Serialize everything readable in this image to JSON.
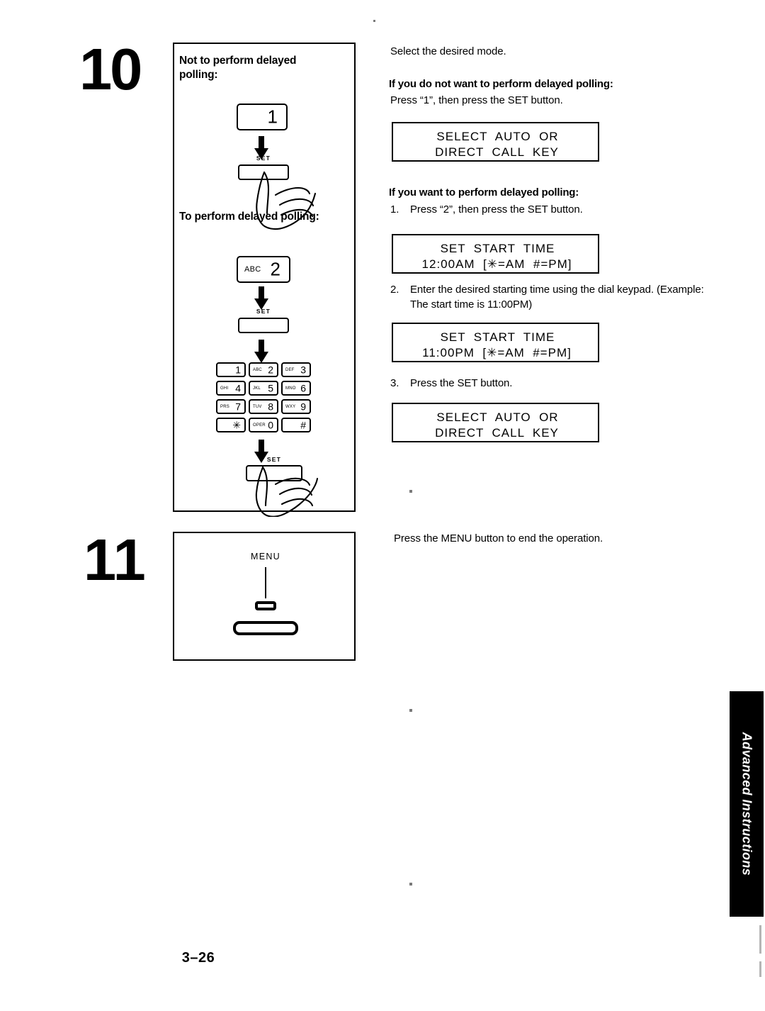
{
  "page": {
    "number": "3–26",
    "side_tab": "Advanced Instructions"
  },
  "steps": [
    {
      "number": "10",
      "panel": {
        "heading_not": "Not to perform delayed polling:",
        "heading_to": "To perform delayed polling:",
        "key_1": {
          "letters": "",
          "digit": "1"
        },
        "key_2": {
          "letters": "ABC",
          "digit": "2"
        },
        "set_label_1": "SET",
        "set_label_2": "SET",
        "set_label_3": "SET",
        "keypad": [
          {
            "letters": "",
            "digit": "1"
          },
          {
            "letters": "ABC",
            "digit": "2"
          },
          {
            "letters": "DEF",
            "digit": "3"
          },
          {
            "letters": "GHI",
            "digit": "4"
          },
          {
            "letters": "JKL",
            "digit": "5"
          },
          {
            "letters": "MNO",
            "digit": "6"
          },
          {
            "letters": "PRS",
            "digit": "7"
          },
          {
            "letters": "TUV",
            "digit": "8"
          },
          {
            "letters": "WXY",
            "digit": "9"
          },
          {
            "letters": "",
            "digit": "✳"
          },
          {
            "letters": "OPER",
            "digit": "0"
          },
          {
            "letters": "",
            "digit": "#"
          }
        ]
      }
    },
    {
      "number": "11",
      "panel": {
        "menu_label": "MENU"
      }
    }
  ],
  "instructions": {
    "select_mode": "Select the desired mode.",
    "heading_do_not": "If you do not want to perform delayed polling:",
    "press_1": "Press “1”, then press the SET button.",
    "heading_want": "If you want to perform delayed polling:",
    "item_1_marker": "1.",
    "item_1_text": "Press “2”, then press the SET button.",
    "item_2_marker": "2.",
    "item_2_text": "Enter the desired starting time using the dial keypad. (Example:  The start time is 11:00PM)",
    "item_3_marker": "3.",
    "item_3_text": "Press the SET button.",
    "menu_end": "Press the MENU button to end the operation."
  },
  "displays": [
    {
      "line1": "SELECT  AUTO  OR",
      "line2": "DIRECT  CALL  KEY"
    },
    {
      "line1": "SET  START  TIME",
      "line2": "12:00AM  [✳=AM  #=PM]"
    },
    {
      "line1": "SET  START  TIME",
      "line2": "11:00PM  [✳=AM  #=PM]"
    },
    {
      "line1": "SELECT  AUTO  OR",
      "line2": "DIRECT  CALL  KEY"
    }
  ],
  "colors": {
    "ink": "#000000",
    "paper": "#ffffff",
    "tab_background": "#000000",
    "tab_text": "#ffffff"
  }
}
